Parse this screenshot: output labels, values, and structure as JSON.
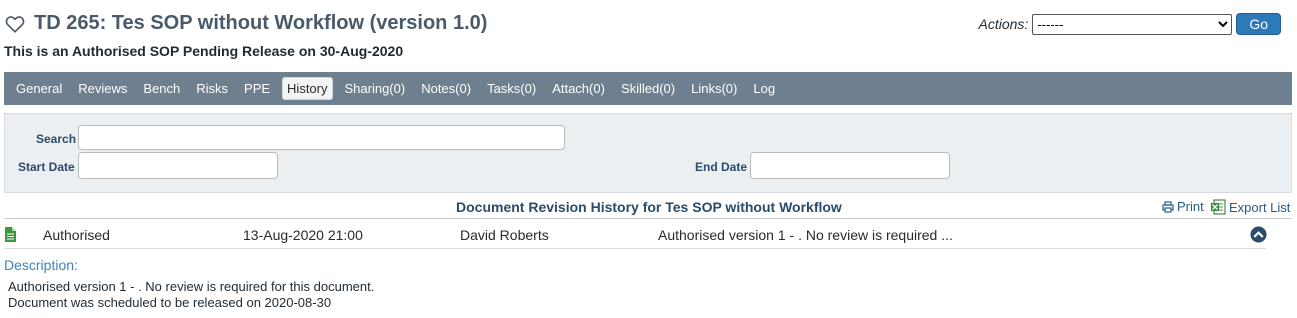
{
  "header": {
    "title": "TD 265: Tes SOP without Workflow (version 1.0)",
    "subtitle": "This is an Authorised SOP Pending Release on 30-Aug-2020"
  },
  "actions": {
    "label": "Actions:",
    "selected": "------",
    "go_label": "Go"
  },
  "tabs": [
    {
      "label": "General"
    },
    {
      "label": "Reviews"
    },
    {
      "label": "Bench"
    },
    {
      "label": "Risks"
    },
    {
      "label": "PPE"
    },
    {
      "label": "History",
      "active": true
    },
    {
      "label": "Sharing(0)"
    },
    {
      "label": "Notes(0)"
    },
    {
      "label": "Tasks(0)"
    },
    {
      "label": "Attach(0)"
    },
    {
      "label": "Skilled(0)"
    },
    {
      "label": "Links(0)"
    },
    {
      "label": "Log"
    }
  ],
  "filters": {
    "search_label": "Search",
    "search_value": "",
    "start_date_label": "Start Date",
    "start_date_value": "",
    "end_date_label": "End Date",
    "end_date_value": ""
  },
  "history": {
    "title": "Document Revision History for Tes SOP without Workflow",
    "print_label": "Print",
    "export_label": "Export List",
    "rows": [
      {
        "status": "Authorised",
        "date": "13-Aug-2020 21:00",
        "user": "David Roberts",
        "summary": "Authorised version 1 - . No review is required ..."
      }
    ]
  },
  "description": {
    "label": "Description:",
    "lines": [
      "Authorised version 1 - . No review is required for this document.",
      "Document was scheduled to be released on 2020-08-30"
    ]
  },
  "colors": {
    "tabbar_bg": "#6e7f8f",
    "accent_blue": "#2c7ab8",
    "label_blue": "#2b4b6a",
    "desc_blue": "#3a84bf",
    "doc_icon_green": "#3a9a3a"
  },
  "icons": {
    "favorite": "heart-outline-icon",
    "print": "printer-icon",
    "export": "excel-icon",
    "row": "document-icon",
    "collapse": "chevron-up-circle-icon"
  }
}
